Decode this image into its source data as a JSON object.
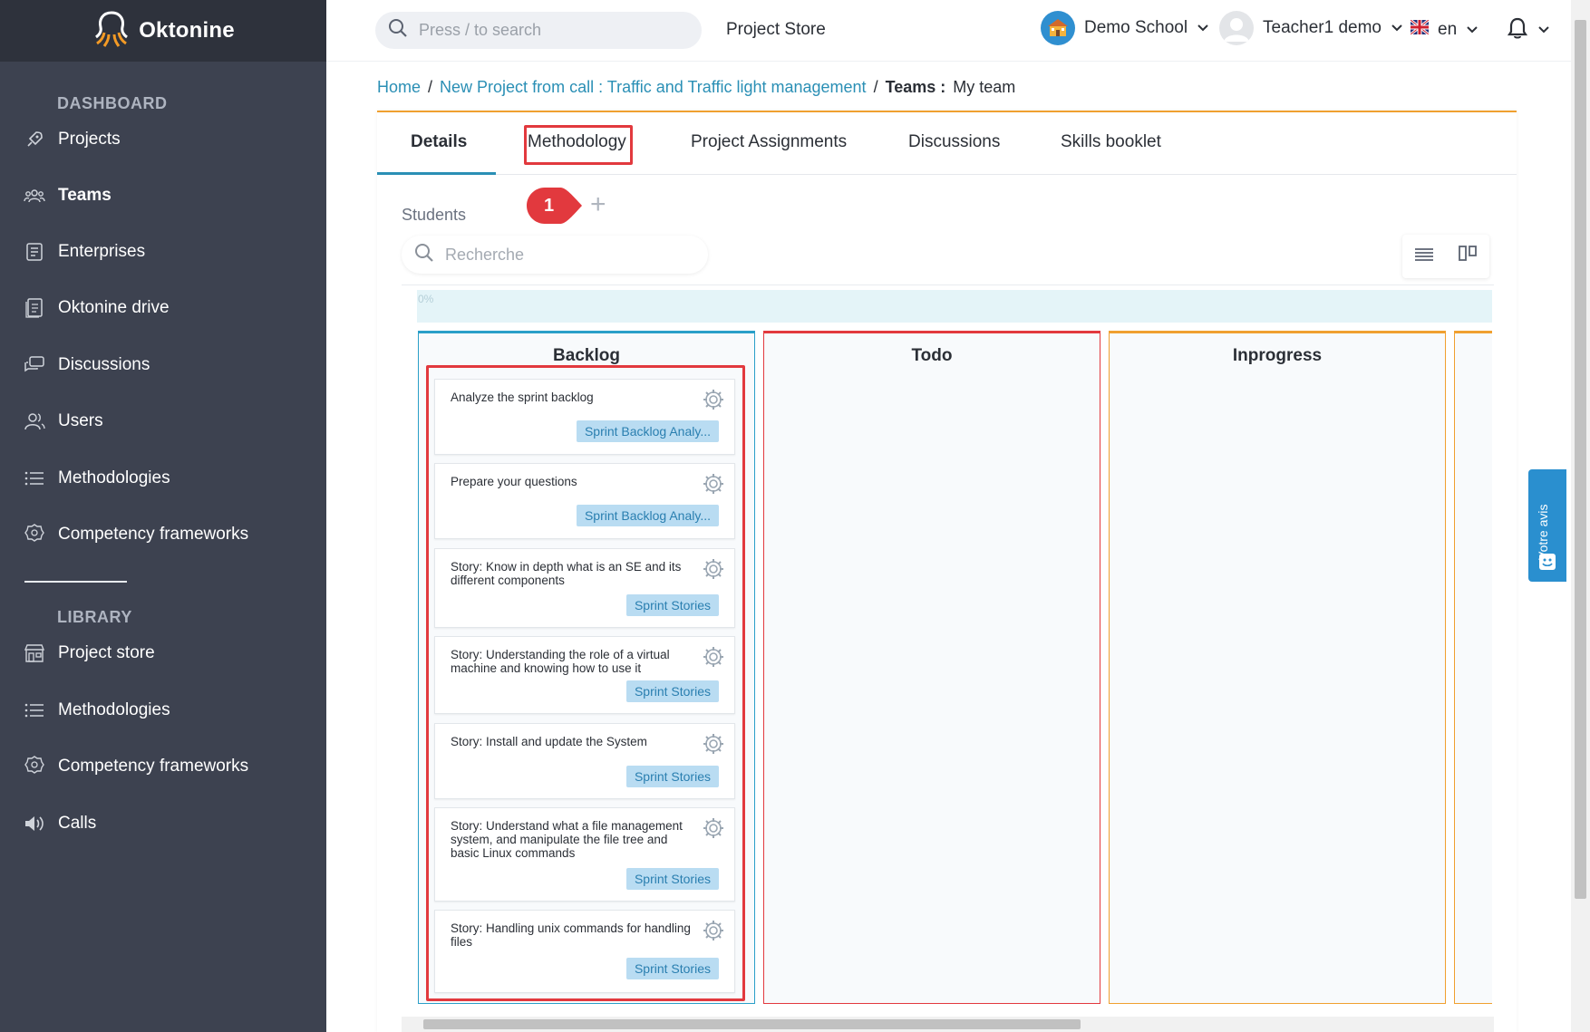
{
  "brand": {
    "name": "Oktonine"
  },
  "sidebar": {
    "sections": [
      {
        "heading": "DASHBOARD",
        "items": [
          {
            "label": "Projects",
            "icon": "rocket-icon"
          },
          {
            "label": "Teams",
            "icon": "team-icon",
            "active": true
          },
          {
            "label": "Enterprises",
            "icon": "enterprise-icon"
          },
          {
            "label": "Oktonine drive",
            "icon": "drive-icon"
          },
          {
            "label": "Discussions",
            "icon": "discussion-icon"
          },
          {
            "label": "Users",
            "icon": "users-icon"
          },
          {
            "label": "Methodologies",
            "icon": "list-icon"
          },
          {
            "label": "Competency frameworks",
            "icon": "badge-icon"
          }
        ]
      },
      {
        "heading": "LIBRARY",
        "items": [
          {
            "label": "Project store",
            "icon": "store-icon"
          },
          {
            "label": "Methodologies",
            "icon": "list-icon"
          },
          {
            "label": "Competency frameworks",
            "icon": "badge-icon"
          },
          {
            "label": "Calls",
            "icon": "speaker-icon"
          }
        ]
      }
    ]
  },
  "topbar": {
    "search_placeholder": "Press / to search",
    "project_store": "Project Store",
    "school": "Demo School",
    "user": "Teacher1 demo",
    "language": "en"
  },
  "breadcrumb": {
    "home": "Home",
    "project": "New Project from call : Traffic and Traffic light management",
    "section": "Teams :",
    "current": "My team"
  },
  "tabs": [
    {
      "label": "Details",
      "active": true
    },
    {
      "label": "Methodology"
    },
    {
      "label": "Project Assignments"
    },
    {
      "label": "Discussions"
    },
    {
      "label": "Skills booklet"
    }
  ],
  "students": {
    "label": "Students",
    "marker": "1",
    "search_placeholder": "Recherche",
    "progress_label": "0%"
  },
  "board": {
    "columns": [
      {
        "title": "Backlog",
        "color": "#2a9fc8",
        "tasks": [
          {
            "title": "Analyze the sprint backlog",
            "tag": "Sprint Backlog Analy..."
          },
          {
            "title": "Prepare your questions",
            "tag": "Sprint Backlog Analy..."
          },
          {
            "title": "Story: Know in depth what is an SE and its different components",
            "tag": "Sprint Stories"
          },
          {
            "title": "Story: Understanding the role of a virtual machine and knowing how to use it",
            "tag": "Sprint Stories"
          },
          {
            "title": "Story: Install and update the System",
            "tag": "Sprint Stories"
          },
          {
            "title": "Story: Understand what a file management system, and manipulate the file tree and basic Linux commands",
            "tag": "Sprint Stories"
          },
          {
            "title": "Story: Handling unix commands for handling files",
            "tag": "Sprint Stories"
          }
        ]
      },
      {
        "title": "Todo",
        "color": "#e2393e",
        "tasks": []
      },
      {
        "title": "Inprogress",
        "color": "#f0a030",
        "tasks": []
      },
      {
        "title": "",
        "color": "#f0a030",
        "tasks": []
      }
    ]
  },
  "feedback": {
    "label": "Votre avis"
  },
  "colors": {
    "sidebar": "#3d4250",
    "accent": "#2a8fb5",
    "highlight": "#e2393e",
    "tag_bg": "#b9dcf2"
  }
}
